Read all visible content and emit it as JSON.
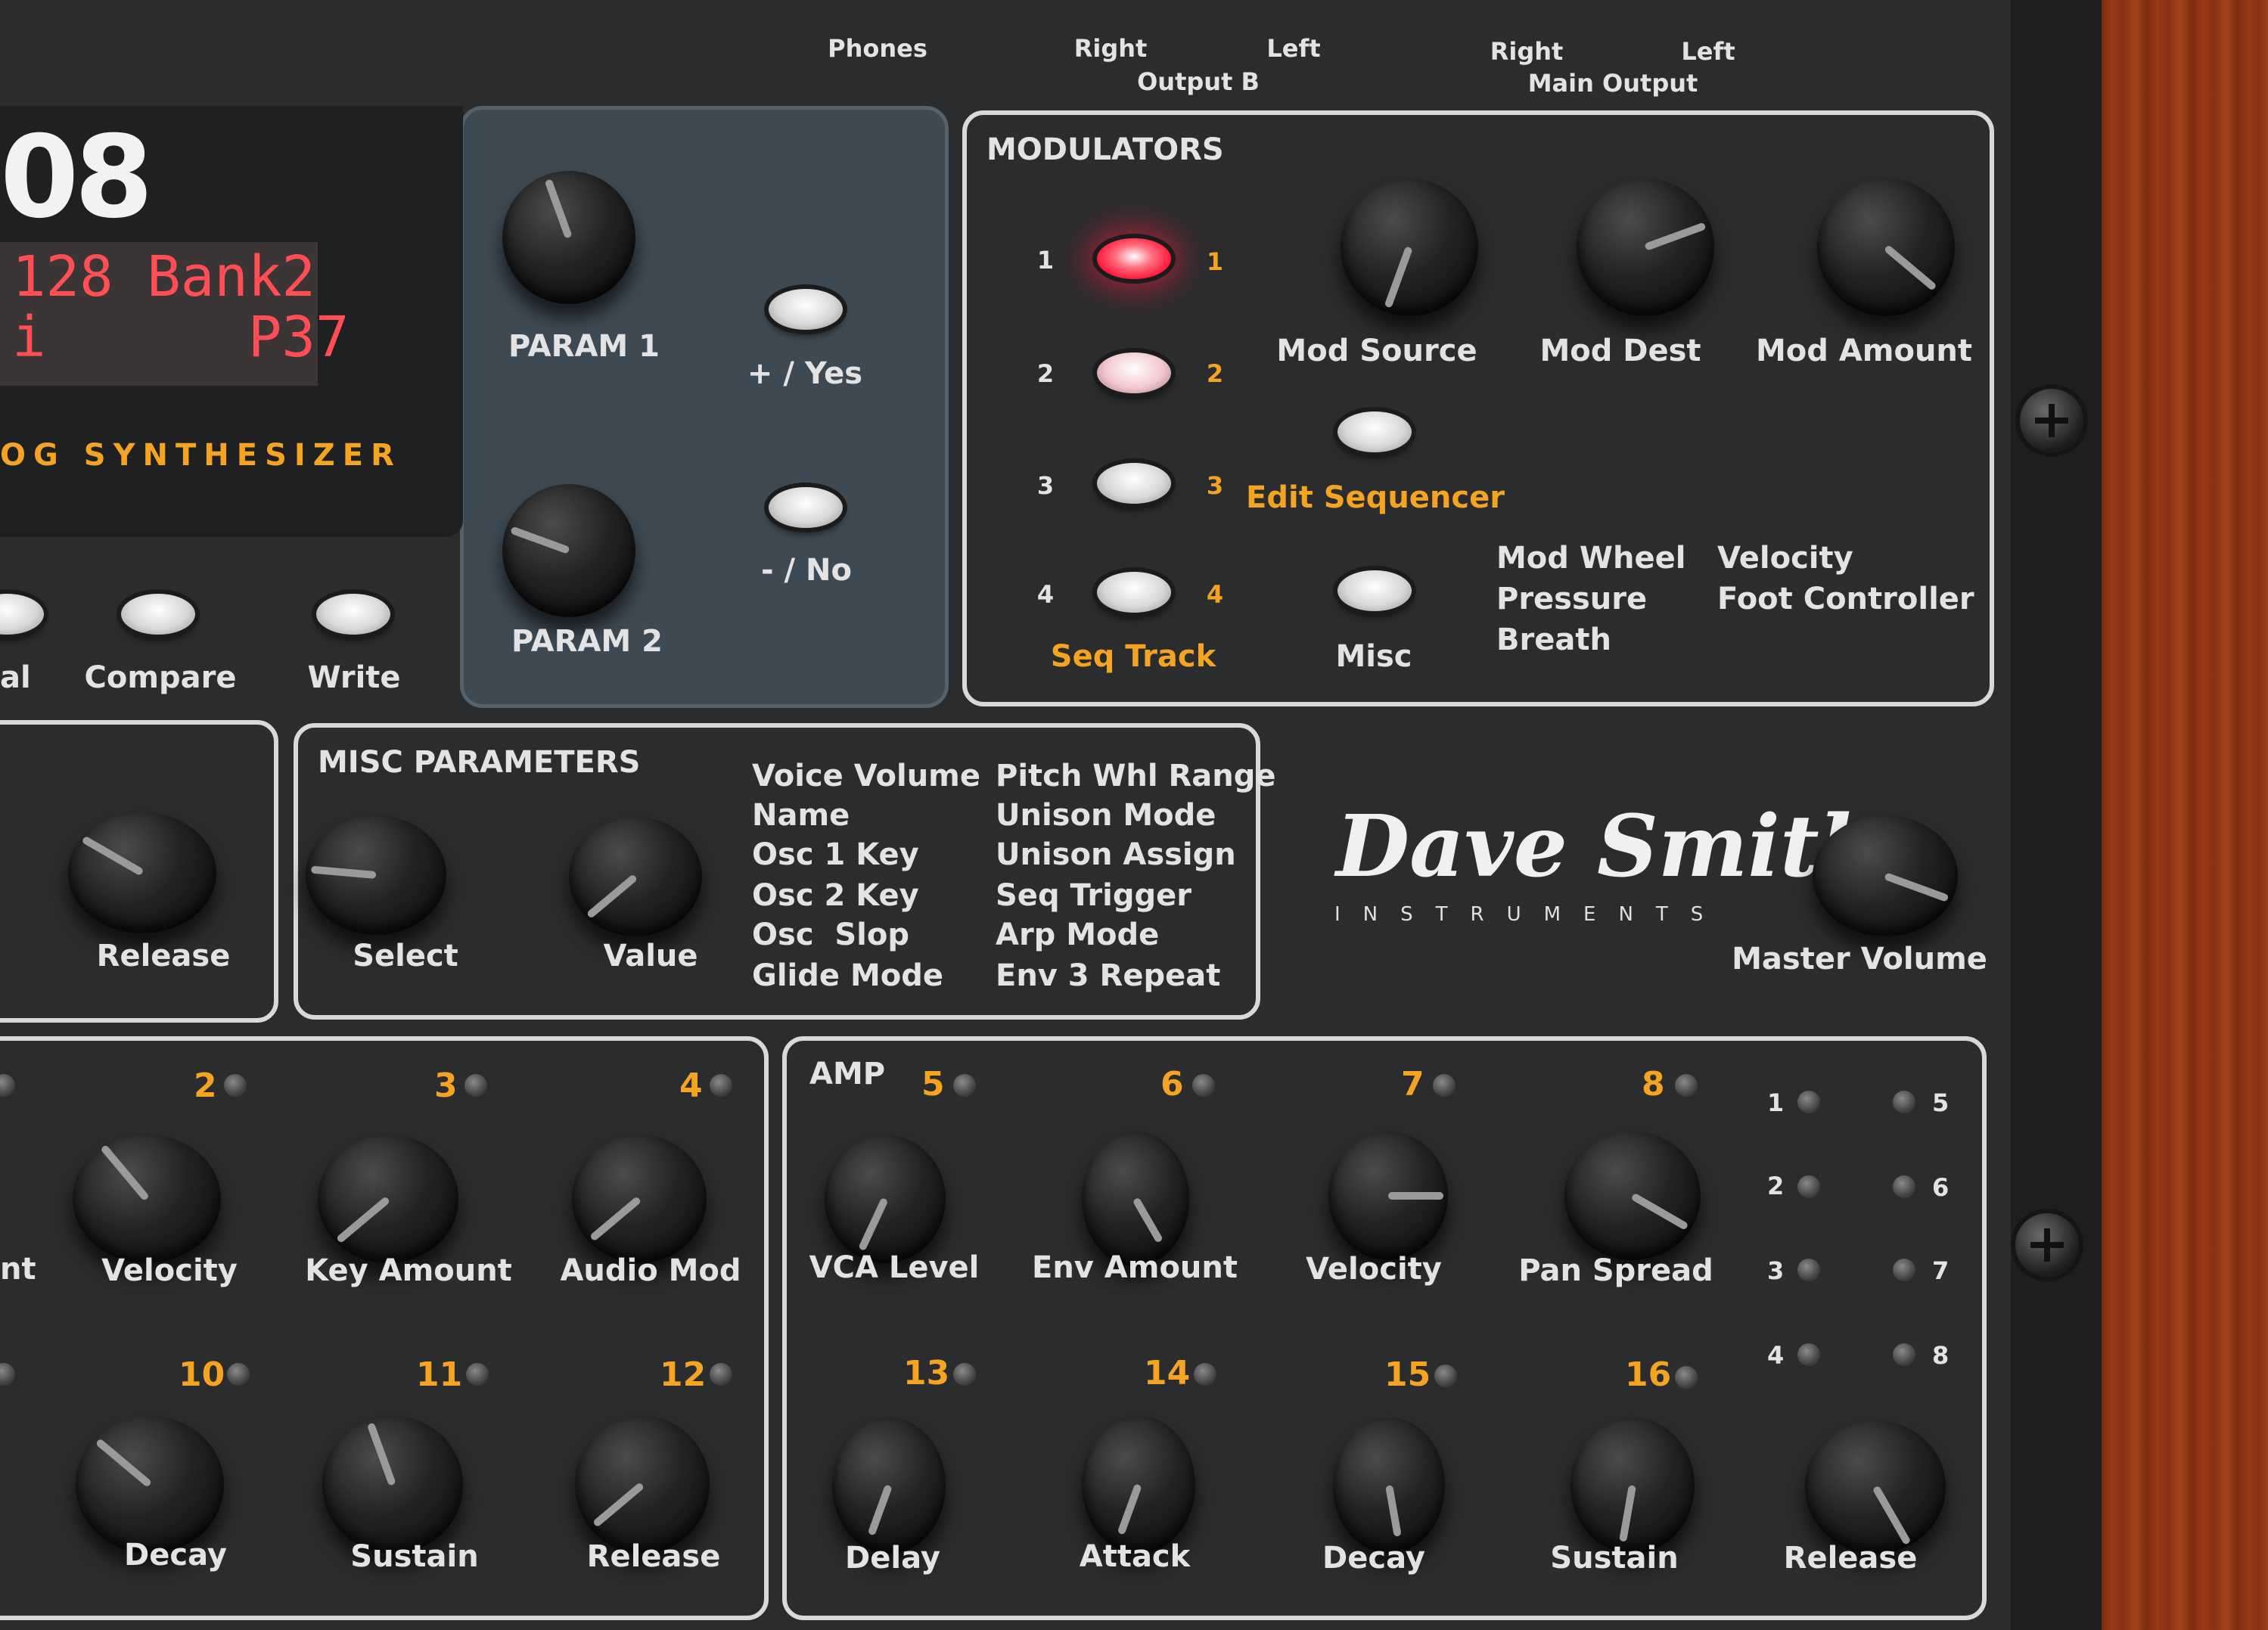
{
  "top": {
    "phones": "Phones",
    "right_b": "Right",
    "left_b": "Left",
    "output_b": "Output B",
    "right_main": "Right",
    "left_main": "Left",
    "main_output": "Main Output"
  },
  "display": {
    "model_fragment": "08",
    "line1": "128 Bank2",
    "line2": "i      P37",
    "subtitle": "OG SYNTHESIZER"
  },
  "buttons_left": {
    "al": "al",
    "compare": "Compare",
    "write": "Write"
  },
  "params": {
    "param1": "PARAM 1",
    "param2": "PARAM 2",
    "yes": "+ / Yes",
    "no": "- / No"
  },
  "modulators": {
    "title": "MODULATORS",
    "row_numbers": [
      "1",
      "2",
      "3",
      "4"
    ],
    "mod_source": "Mod Source",
    "mod_dest": "Mod Dest",
    "mod_amount": "Mod Amount",
    "edit_sequencer": "Edit Sequencer",
    "seq_track": "Seq Track",
    "misc": "Misc",
    "sources_col1": [
      "Mod Wheel",
      "Pressure",
      "Breath"
    ],
    "sources_col2": [
      "Velocity",
      "Foot Controller"
    ]
  },
  "left_env": {
    "release": "Release"
  },
  "misc_params": {
    "title": "MISC PARAMETERS",
    "select": "Select",
    "value": "Value",
    "col1": [
      "Voice Volume",
      "Name",
      "Osc 1 Key",
      "Osc 2 Key",
      "Osc  Slop",
      "Glide Mode"
    ],
    "col2": [
      "Pitch Whl Range",
      "Unison Mode",
      "Unison Assign",
      "Seq Trigger",
      "Arp Mode",
      "Env 3 Repeat"
    ]
  },
  "brand": {
    "script": "Dave Smith",
    "sub": "INSTRUMENTS"
  },
  "master": {
    "label": "Master Volume"
  },
  "filter": {
    "step_numbers_top": [
      "2",
      "3",
      "4"
    ],
    "step_numbers_bottom": [
      "10",
      "11",
      "12"
    ],
    "knob_labels_top": [
      "nt",
      "Velocity",
      "Key Amount",
      "Audio Mod"
    ],
    "knob_labels_bottom": [
      "Decay",
      "Sustain",
      "Release"
    ]
  },
  "amp": {
    "title": "AMP",
    "step_numbers_top": [
      "5",
      "6",
      "7",
      "8"
    ],
    "step_numbers_bottom": [
      "13",
      "14",
      "15",
      "16"
    ],
    "knob_labels_top": [
      "VCA Level",
      "Env Amount",
      "Velocity",
      "Pan Spread"
    ],
    "knob_labels_bottom": [
      "Delay",
      "Attack",
      "Decay",
      "Sustain",
      "Release"
    ],
    "voice_leds_left": [
      "1",
      "2",
      "3",
      "4"
    ],
    "voice_leds_right": [
      "5",
      "6",
      "7",
      "8"
    ]
  }
}
